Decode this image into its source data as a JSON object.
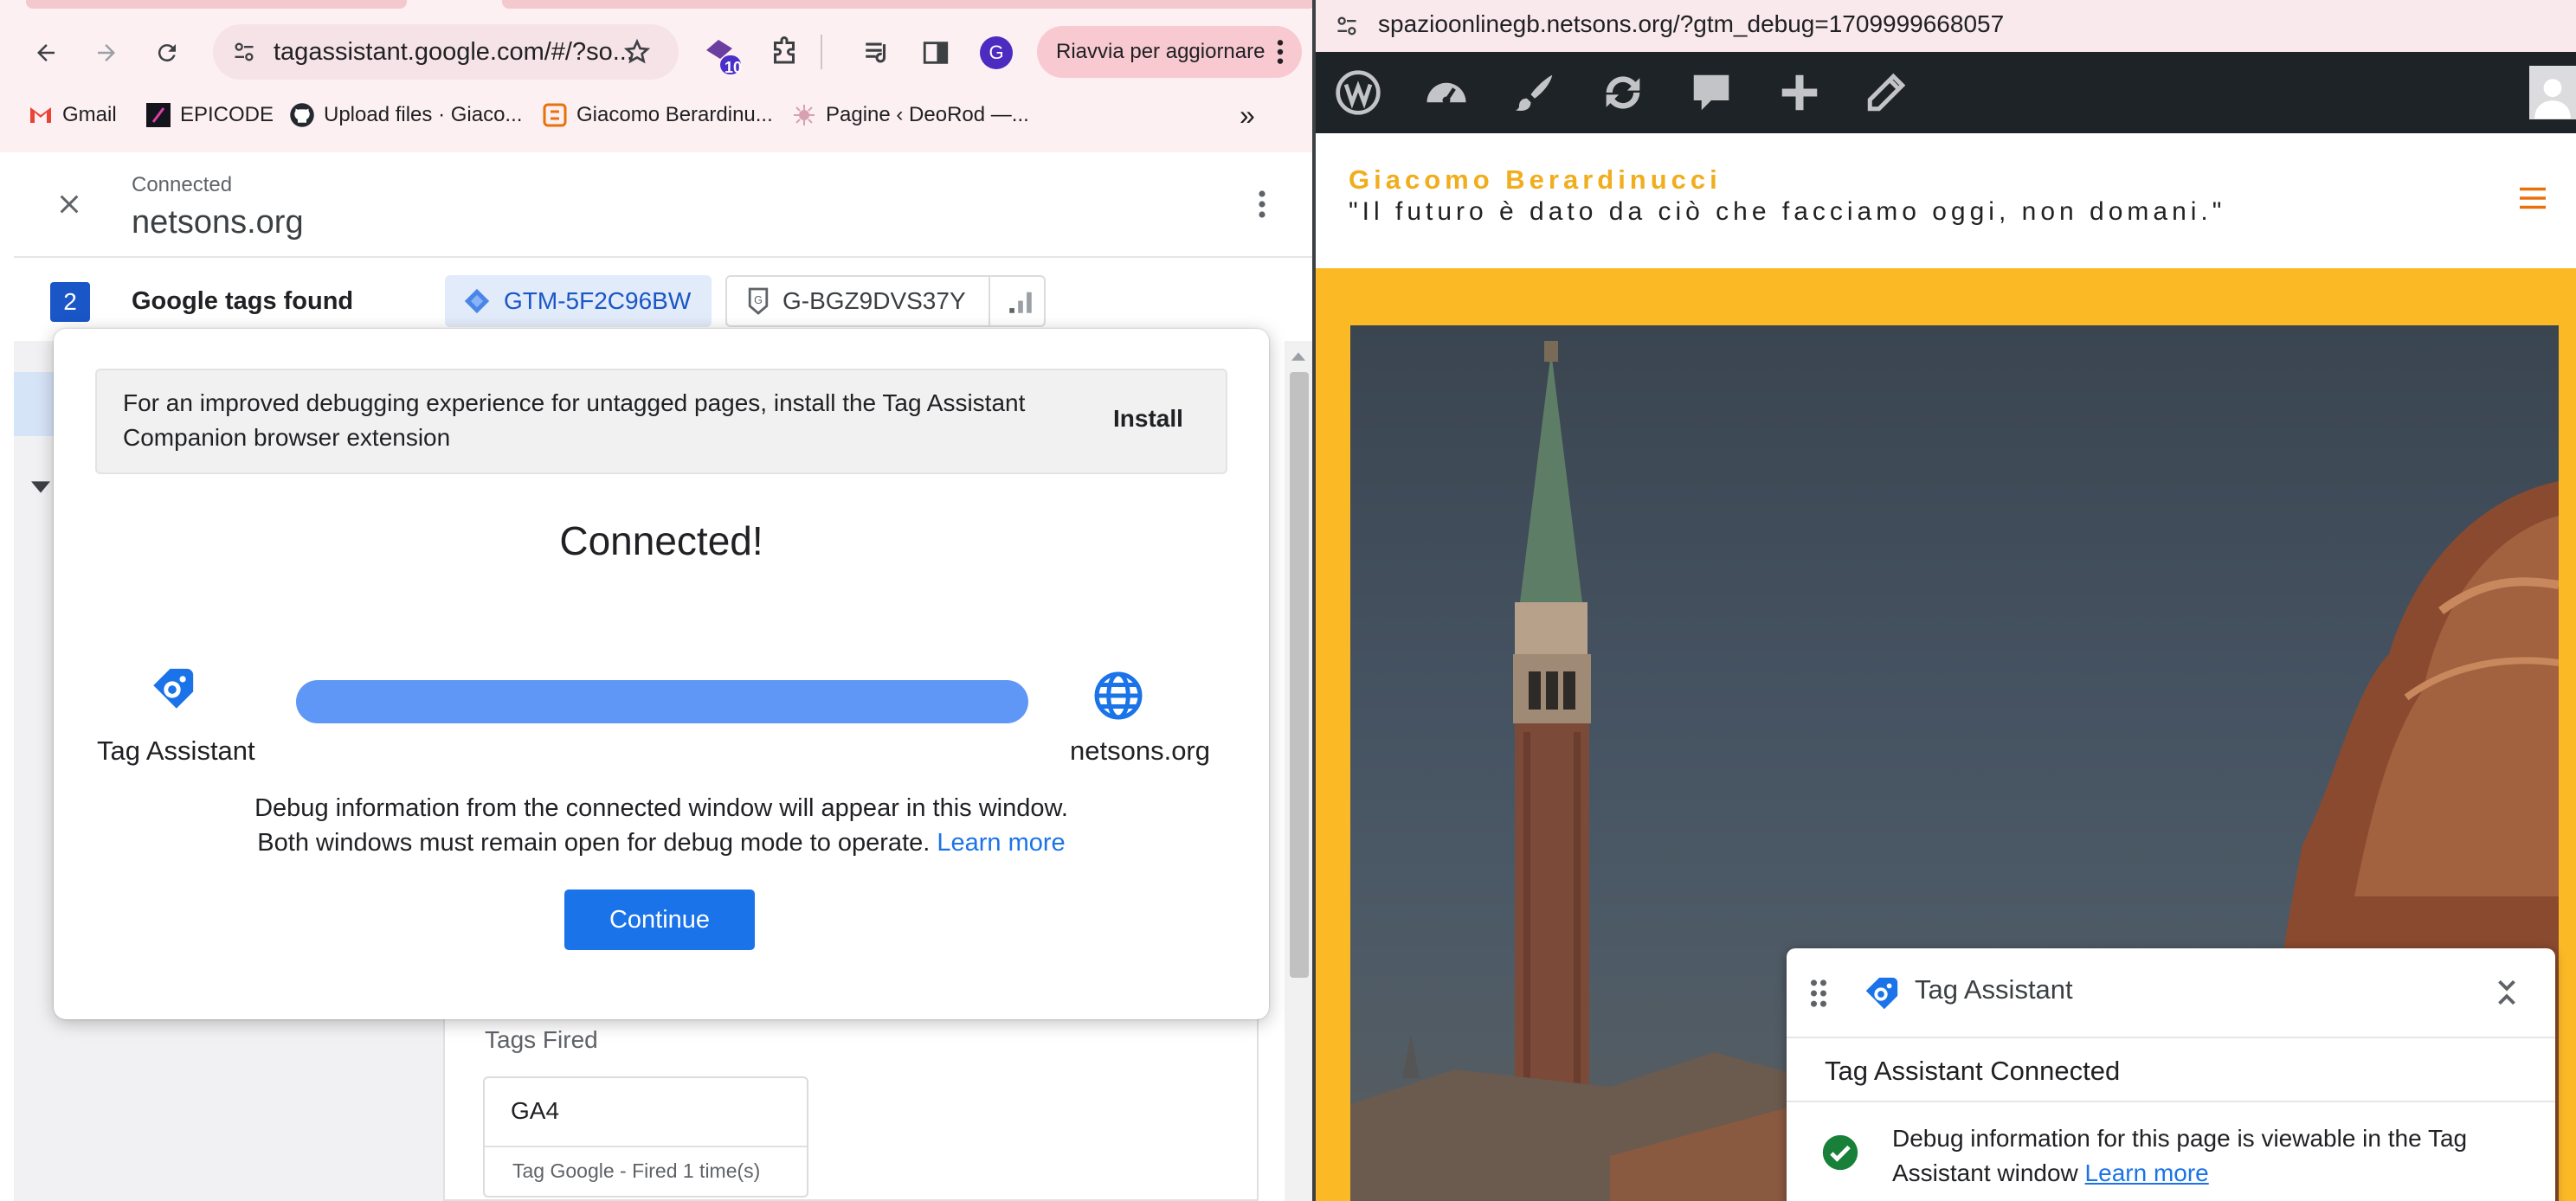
{
  "browser_left": {
    "url": "tagassistant.google.com/#/?so...",
    "extension_badge": "10",
    "profile_initial": "G",
    "update_label": "Riavvia per aggiornare",
    "bookmarks": [
      {
        "label": "Gmail",
        "icon": "gmail-icon"
      },
      {
        "label": "EPICODE",
        "icon": "epicode-icon"
      },
      {
        "label": "Upload files · Giaco...",
        "icon": "github-icon"
      },
      {
        "label": "Giacomo Berardinu...",
        "icon": "site-icon"
      },
      {
        "label": "Pagine ‹ DeoRod —...",
        "icon": "deorod-icon"
      }
    ],
    "bookmarks_more": "»"
  },
  "tag_assistant": {
    "status_label": "Connected",
    "domain": "netsons.org",
    "tags_count": "2",
    "tags_found_label": "Google tags found",
    "tag_ids": [
      "GTM-5F2C96BW",
      "G-BGZ9DVS37Y"
    ],
    "tags_fired_label": "Tags Fired",
    "fired_tag_name": "GA4",
    "fired_tag_sub": "Tag Google - Fired 1 time(s)"
  },
  "dialog": {
    "banner_text": "For an improved debugging experience for untagged pages, install the Tag Assistant Companion browser extension",
    "install_label": "Install",
    "title": "Connected!",
    "left_label": "Tag Assistant",
    "right_label": "netsons.org",
    "progress": 1.0,
    "info_line1": "Debug information from the connected window will appear in this window.",
    "info_line2": "Both windows must remain open for debug mode to operate.",
    "learn_more": "Learn more",
    "continue_label": "Continue"
  },
  "browser_right": {
    "url": "spazioonlinegb.netsons.org/?gtm_debug=1709999668057",
    "site_name": "Giacomo Berardinucci",
    "site_tagline": "\"Il futuro è dato da ciò che facciamo oggi, non domani.\""
  },
  "widget": {
    "title": "Tag Assistant",
    "connected": "Tag Assistant Connected",
    "message": "Debug information for this page is viewable in the Tag Assistant window",
    "learn_more": "Learn more"
  },
  "colors": {
    "accent_blue": "#1a73e8",
    "site_yellow": "#fbb926",
    "site_name_orange": "#f0ae1e",
    "wp_bar": "#1d2327"
  }
}
